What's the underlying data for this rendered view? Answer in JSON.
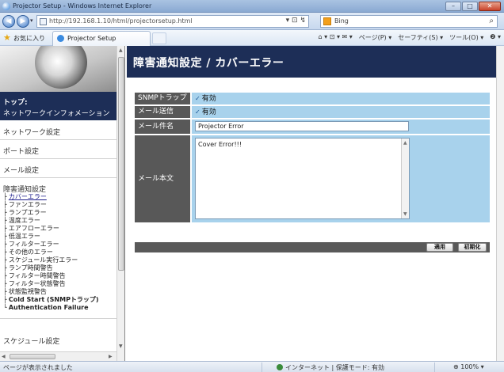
{
  "window": {
    "title": "Projector Setup - Windows Internet Explorer",
    "min_glyph": "–",
    "max_glyph": "□",
    "close_glyph": "✕"
  },
  "address_bar": {
    "url": "http://192.168.1.10/html/projectorsetup.html",
    "search_placeholder": "Bing",
    "back_glyph": "◀",
    "forward_glyph": "▶",
    "tools": "▾ ⊡ ↯"
  },
  "favorites_bar": {
    "favorites_label": "お気に入り",
    "tab_label": "Projector Setup",
    "commands": [
      "ページ(P) ▾",
      "セーフティ(S) ▾",
      "ツール(O) ▾",
      "❷ ▾"
    ],
    "home_tools": "⌂ ▾ ⊡ ▾ ✉ ▾"
  },
  "sidebar": {
    "top_label": "トップ:",
    "top_sub": "ネットワークインフォメーション",
    "items": [
      "ネットワーク設定",
      "ポート設定",
      "メール設定",
      "障害通知設定"
    ],
    "sub_items": [
      "カバーエラー",
      "ファンエラー",
      "ランプエラー",
      "温度エラー",
      "エアフローエラー",
      "低温エラー",
      "フィルターエラー",
      "その他のエラー",
      "スケジュール実行エラー",
      "ランプ時間警告",
      "フィルター時間警告",
      "フィルター状態警告",
      "状態監視警告",
      "Cold Start (SNMPトラップ)",
      "Authentication Failure"
    ],
    "bottom_item": "スケジュール設定"
  },
  "main": {
    "title": "障害通知設定 / カバーエラー",
    "rows": [
      {
        "label": "SNMPトラップ",
        "checked": true,
        "value": "有効"
      },
      {
        "label": "メール送信",
        "checked": true,
        "value": "有効"
      },
      {
        "label": "メール件名",
        "input_value": "Projector Error"
      },
      {
        "label": "メール本文",
        "textarea_value": "Cover Error!!!"
      }
    ],
    "check_glyph": "✓",
    "apply_label": "適用",
    "reset_label": "初期化"
  },
  "status_bar": {
    "left_text": "ページが表示されました",
    "zone_text": "インターネット | 保護モード: 有効",
    "zoom_text": "⊕ 100% ▾"
  },
  "colors": {
    "header_navy": "#1d2e57",
    "row_label_gray": "#585858",
    "row_value_blue": "#a8d2ec"
  }
}
